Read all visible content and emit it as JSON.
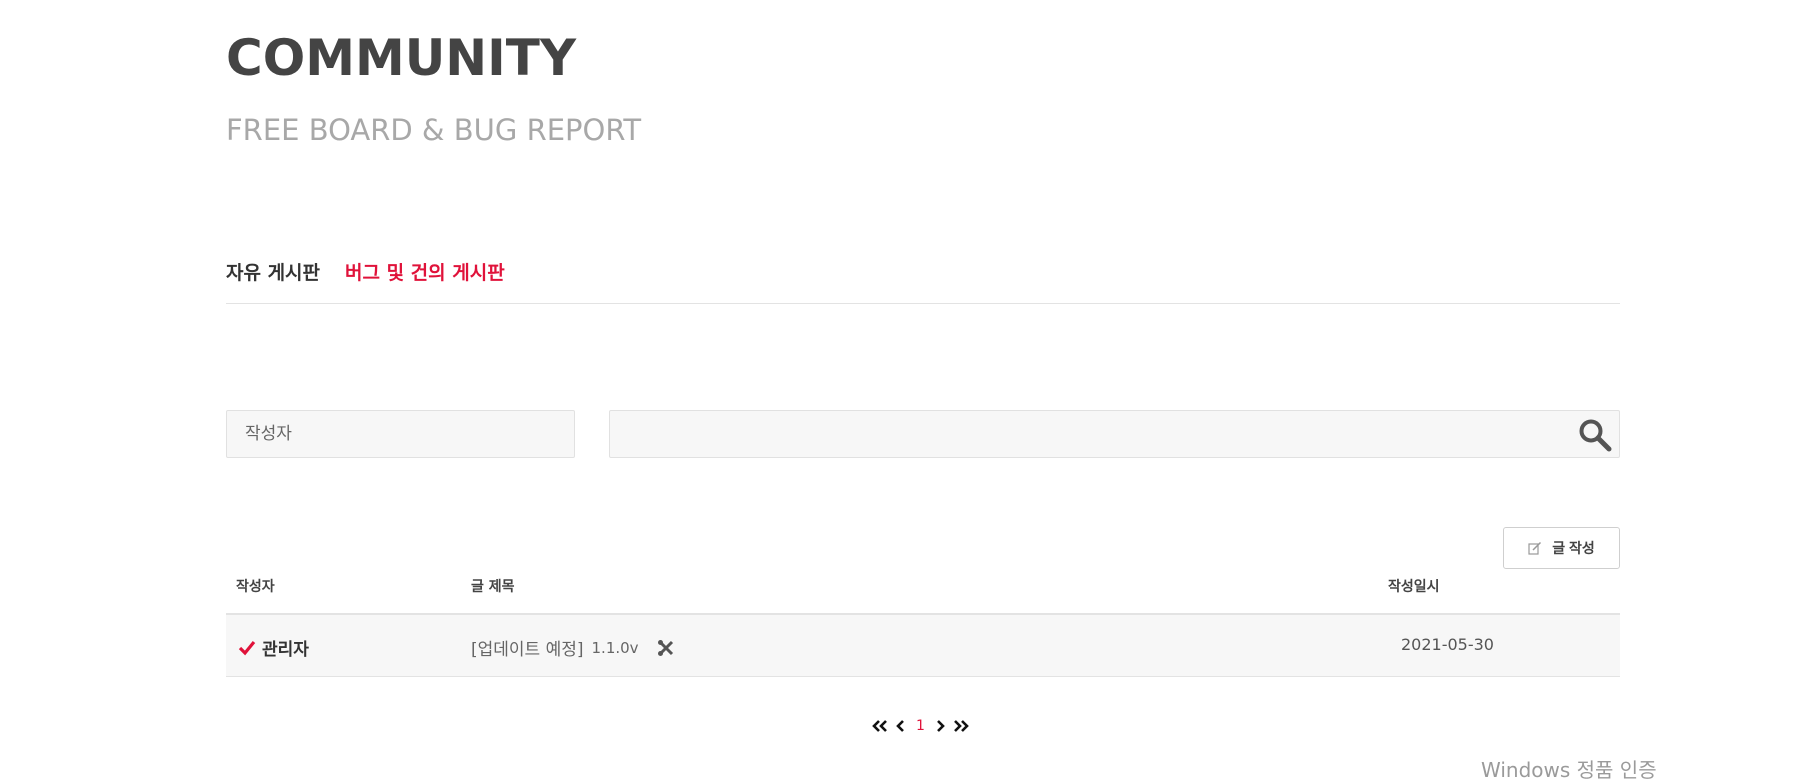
{
  "header": {
    "title": "COMMUNITY",
    "subtitle": "FREE BOARD & BUG REPORT"
  },
  "tabs": [
    {
      "label": "자유 게시판",
      "active": false
    },
    {
      "label": "버그 및 건의 게시판",
      "active": true
    }
  ],
  "search": {
    "author_placeholder": "작성자",
    "query_value": "",
    "icon": "search-icon"
  },
  "write_button": {
    "label": "글 작성",
    "icon": "edit-icon"
  },
  "table": {
    "columns": [
      "작성자",
      "글 제목",
      "작성일시"
    ],
    "rows": [
      {
        "author": "관리자",
        "author_icon": "check-icon",
        "title": "[업데이트 예정]",
        "version": "1.1.0v",
        "title_icon": "tools-icon",
        "date": "2021-05-30"
      }
    ]
  },
  "pagination": {
    "current_page": "1"
  },
  "system": {
    "watermark": "Windows 정품 인증"
  },
  "colors": {
    "accent": "#e0123a",
    "title": "#444444",
    "subtitle": "#a8a8a8"
  }
}
